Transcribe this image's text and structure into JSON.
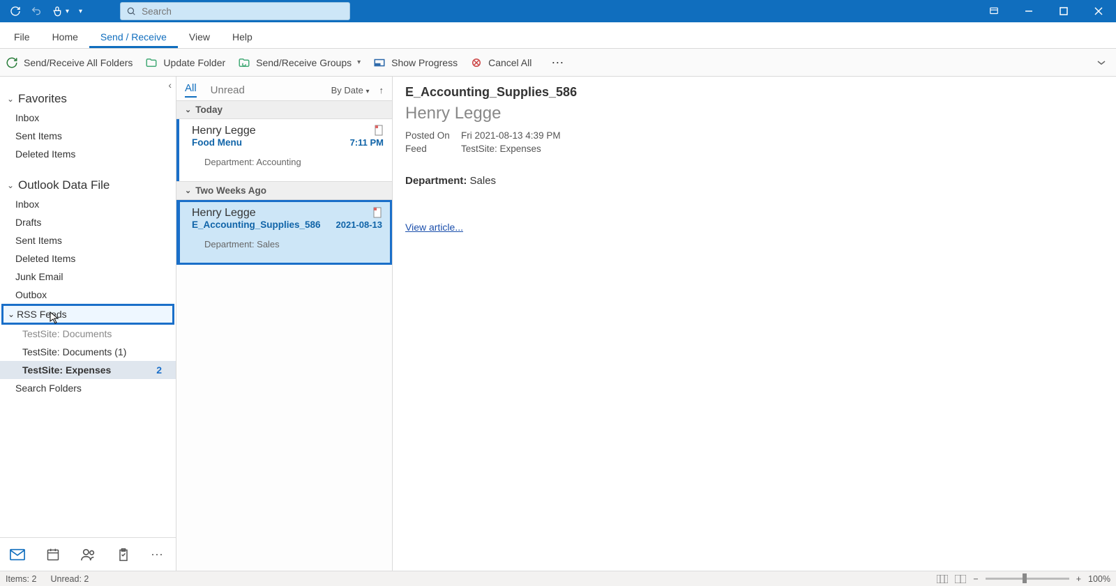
{
  "titlebar": {
    "search_placeholder": "Search"
  },
  "menu": {
    "tabs": [
      "File",
      "Home",
      "Send / Receive",
      "View",
      "Help"
    ],
    "active_index": 2
  },
  "ribbon": {
    "send_receive_all": "Send/Receive All Folders",
    "update_folder": "Update Folder",
    "send_receive_groups": "Send/Receive Groups",
    "show_progress": "Show Progress",
    "cancel_all": "Cancel All"
  },
  "sidebar": {
    "favorites_label": "Favorites",
    "data_file_label": "Outlook Data File",
    "fav_items": [
      "Inbox",
      "Sent Items",
      "Deleted Items"
    ],
    "data_items": [
      "Inbox",
      "Drafts",
      "Sent Items",
      "Deleted Items",
      "Junk Email",
      "Outbox"
    ],
    "rss_label": "RSS Feeds",
    "rss_items": [
      {
        "label": "TestSite: Documents",
        "count": ""
      },
      {
        "label": "TestSite: Documents (1)",
        "count": ""
      },
      {
        "label": "TestSite: Expenses",
        "count": "2",
        "selected": true
      }
    ],
    "search_folders": "Search Folders"
  },
  "list": {
    "tabs": {
      "all": "All",
      "unread": "Unread"
    },
    "sort": "By Date",
    "groups": [
      {
        "label": "Today",
        "messages": [
          {
            "from": "Henry Legge",
            "subject": "Food Menu",
            "time": "7:11 PM",
            "preview": "Department: Accounting"
          }
        ]
      },
      {
        "label": "Two Weeks Ago",
        "messages": [
          {
            "from": "Henry Legge",
            "subject": "E_Accounting_Supplies_586",
            "time": "2021-08-13",
            "preview": "Department: Sales",
            "selected": true
          }
        ]
      }
    ]
  },
  "preview": {
    "title": "E_Accounting_Supplies_586",
    "sender": "Henry Legge",
    "posted_label": "Posted On",
    "posted_value": "Fri 2021-08-13 4:39 PM",
    "feed_label": "Feed",
    "feed_value": "TestSite: Expenses",
    "body_label": "Department:",
    "body_value": "Sales",
    "link_text": "View article..."
  },
  "status": {
    "items": "Items: 2",
    "unread": "Unread: 2",
    "zoom": "100%"
  }
}
